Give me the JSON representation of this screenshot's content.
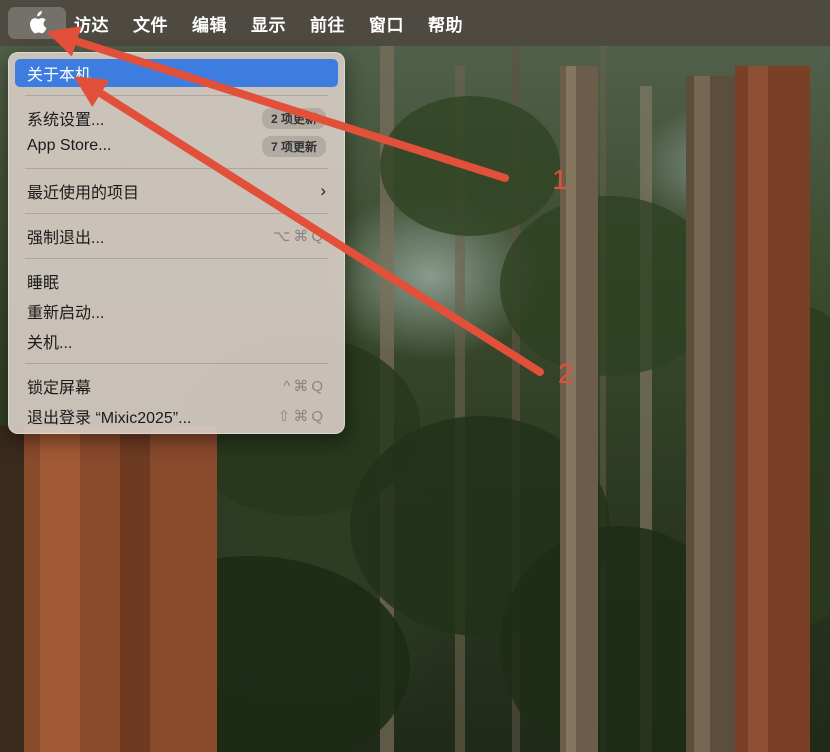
{
  "menubar": {
    "apple_icon": "apple-logo",
    "items": [
      "访达",
      "文件",
      "编辑",
      "显示",
      "前往",
      "窗口",
      "帮助"
    ]
  },
  "apple_menu": {
    "about": "关于本机",
    "settings": {
      "label": "系统设置...",
      "badge": "2 项更新"
    },
    "app_store": {
      "label": "App Store...",
      "badge": "7 项更新"
    },
    "recent": "最近使用的项目",
    "force_quit": {
      "label": "强制退出...",
      "shortcut": "⌥⌘Q"
    },
    "sleep": "睡眠",
    "restart": "重新启动...",
    "shutdown": "关机...",
    "lock": {
      "label": "锁定屏幕",
      "shortcut": "^⌘Q"
    },
    "logout": {
      "label": "退出登录 “Mixic2025”...",
      "shortcut": "⇧⌘Q"
    }
  },
  "annotations": {
    "arrow_1_label": "1",
    "arrow_2_label": "2",
    "color": "#e2503a"
  },
  "colors": {
    "menubar_bg": "#4e4a42",
    "highlight": "#3d7de0"
  }
}
